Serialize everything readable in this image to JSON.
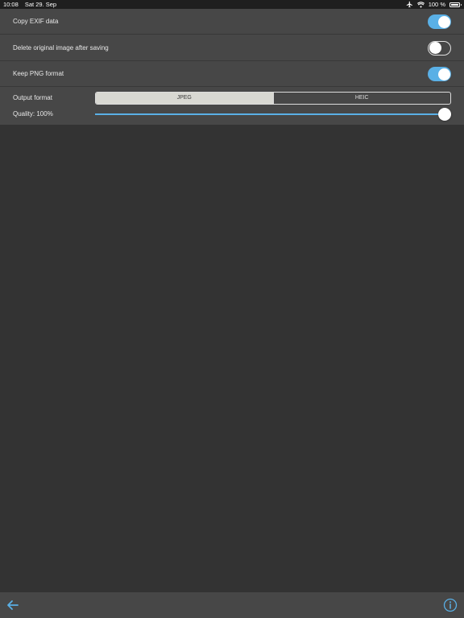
{
  "status_bar": {
    "time": "10:08",
    "date": "Sat 29. Sep",
    "battery_text": "100 %",
    "icons": [
      "airplane-icon",
      "wifi-icon",
      "battery-icon"
    ]
  },
  "settings": {
    "copy_exif": {
      "label": "Copy EXIF data",
      "enabled": true
    },
    "delete_original": {
      "label": "Delete original image after saving",
      "enabled": false
    },
    "keep_png": {
      "label": "Keep PNG format",
      "enabled": true
    },
    "output_format": {
      "label": "Output format",
      "options": [
        "JPEG",
        "HEIC"
      ],
      "selected": "JPEG"
    },
    "quality": {
      "label": "Quality: 100%",
      "value_fraction": 1.0
    }
  },
  "toolbar": {
    "back_icon": "back-arrow-icon",
    "info_icon": "info-icon"
  },
  "colors": {
    "accent": "#5ab0e6",
    "background": "#333333",
    "panel": "#474747",
    "status_bar": "#1f1f1f"
  }
}
